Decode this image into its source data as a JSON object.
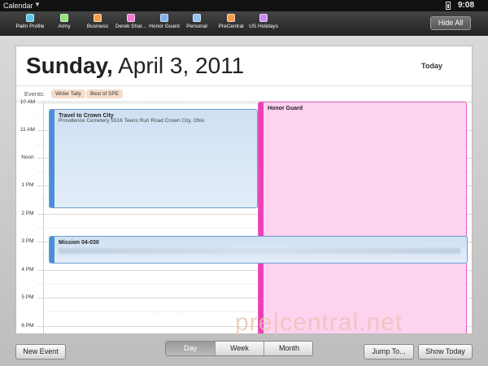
{
  "status_bar": {
    "app_name": "Calendar",
    "time": "9:08"
  },
  "calendar_bar": {
    "calendars": [
      {
        "label": "Palm Profile",
        "color": "#5ec8e8"
      },
      {
        "label": "Army",
        "color": "#8fe37a"
      },
      {
        "label": "Business",
        "color": "#f2a04a"
      },
      {
        "label": "Derek Shar...",
        "color": "#f07ad0"
      },
      {
        "label": "Honor Guard",
        "color": "#7fb0f0"
      },
      {
        "label": "Personal",
        "color": "#8fc4f0"
      },
      {
        "label": "PreCentral",
        "color": "#f59a4a"
      },
      {
        "label": "US Holidays",
        "color": "#c78af0"
      }
    ],
    "hide_all_label": "Hide All"
  },
  "header": {
    "day_name": "Sunday,",
    "date": "April 3, 2011",
    "today_label": "Today"
  },
  "all_day": {
    "label": "Events:",
    "items": [
      "Writer Tally",
      "Best of SPE"
    ]
  },
  "timeline": {
    "hours": [
      "10 AM",
      "11 AM",
      "Noon",
      "1 PM",
      "2 PM",
      "3 PM",
      "4 PM",
      "5 PM",
      "6 PM"
    ]
  },
  "events": {
    "travel": {
      "title": "Travel to Crown City",
      "location": "Providence Cemetery 5518 Teens Run Road Crown City, Ohio"
    },
    "honor": {
      "title": "Honor Guard"
    },
    "mission": {
      "title": "Mission 04-030"
    }
  },
  "watermark": "pre|central.net",
  "bottom_bar": {
    "new_event": "New Event",
    "views": [
      "Day",
      "Week",
      "Month"
    ],
    "active_view": "Day",
    "jump_to": "Jump To...",
    "show_today": "Show Today"
  }
}
